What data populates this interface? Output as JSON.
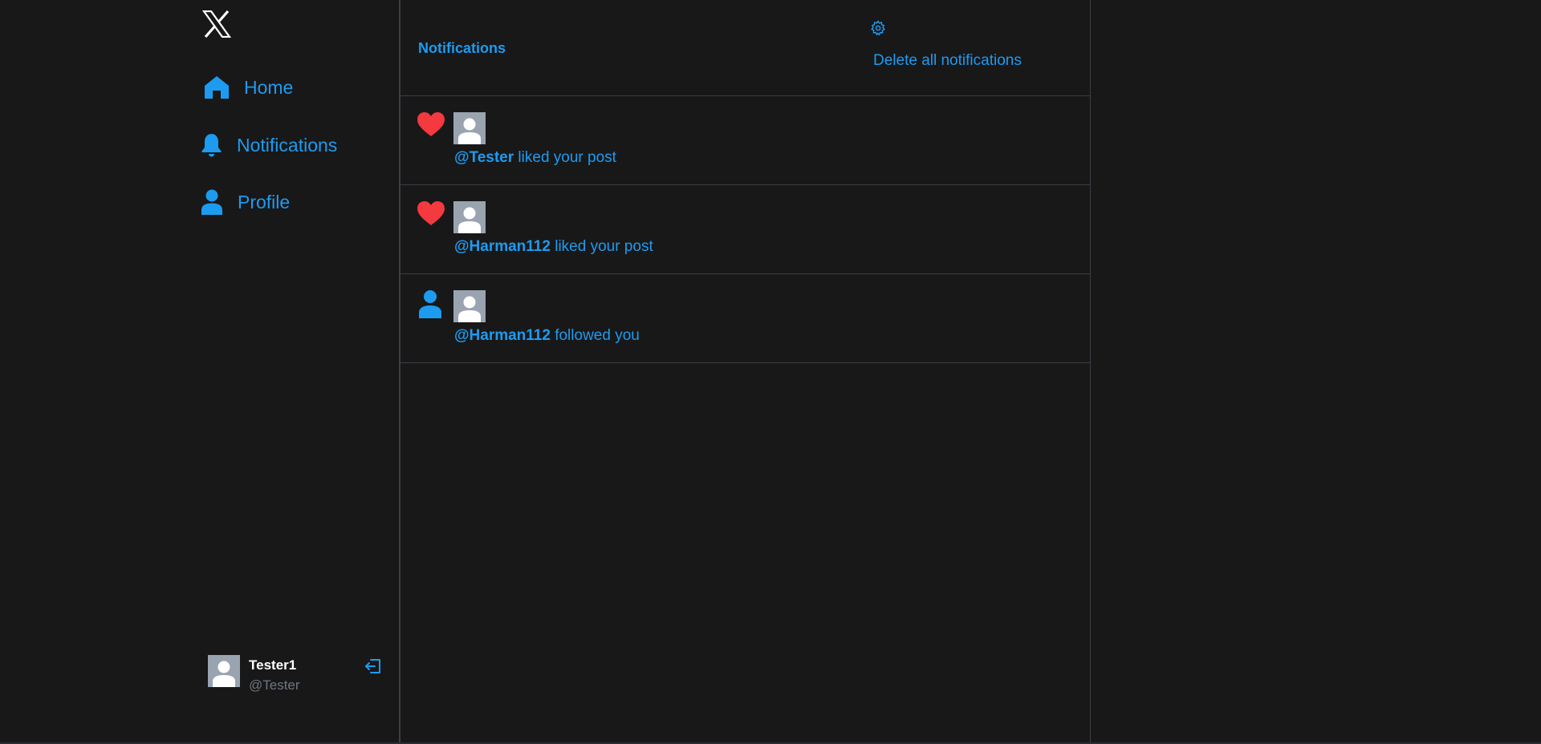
{
  "sidebar": {
    "logo_icon": "x-logo-icon",
    "nav": [
      {
        "label": "Home",
        "icon": "home-icon"
      },
      {
        "label": "Notifications",
        "icon": "bell-icon"
      },
      {
        "label": "Profile",
        "icon": "user-icon"
      }
    ],
    "user": {
      "name": "Tester1",
      "handle": "@Tester"
    }
  },
  "header": {
    "title": "Notifications",
    "delete_all_label": "Delete all notifications"
  },
  "notifications": [
    {
      "type": "like",
      "icon": "heart-icon",
      "handle": "@Tester",
      "action": " liked your post"
    },
    {
      "type": "like",
      "icon": "heart-icon",
      "handle": "@Harman112",
      "action": " liked your post"
    },
    {
      "type": "follow",
      "icon": "user-icon",
      "handle": "@Harman112",
      "action": " followed you"
    }
  ],
  "colors": {
    "background": "#181819",
    "accent": "#1d9bf0",
    "like": "#f4393f",
    "divider": "#3a3f45",
    "avatar": "#9aa4b0"
  }
}
